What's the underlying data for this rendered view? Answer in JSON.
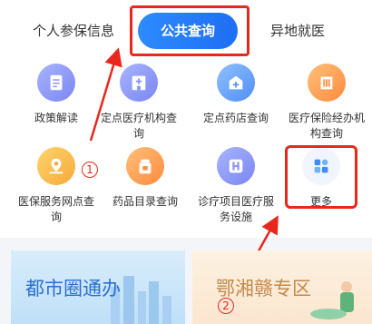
{
  "tabs": [
    {
      "label": "个人参保信息"
    },
    {
      "label": "公共查询"
    },
    {
      "label": "异地就医"
    }
  ],
  "services": [
    {
      "label": "政策解读",
      "icon": "document-icon"
    },
    {
      "label": "定点医疗机构查询",
      "icon": "hospital-icon"
    },
    {
      "label": "定点药店查询",
      "icon": "pharmacy-icon"
    },
    {
      "label": "医疗保险经办机构查询",
      "icon": "building-icon"
    },
    {
      "label": "医保服务网点查询",
      "icon": "map-pin-icon"
    },
    {
      "label": "药品目录查询",
      "icon": "medicine-icon"
    },
    {
      "label": "诊疗项目医疗服务设施",
      "icon": "h-icon"
    },
    {
      "label": "更多",
      "icon": "grid-icon"
    }
  ],
  "annotations": {
    "one": "1",
    "two": "2"
  },
  "banners": [
    {
      "title": "都市圈通办"
    },
    {
      "title": "鄂湘赣专区"
    }
  ],
  "colors": {
    "accent": "#1f6ef5",
    "highlight": "#e8281c"
  }
}
